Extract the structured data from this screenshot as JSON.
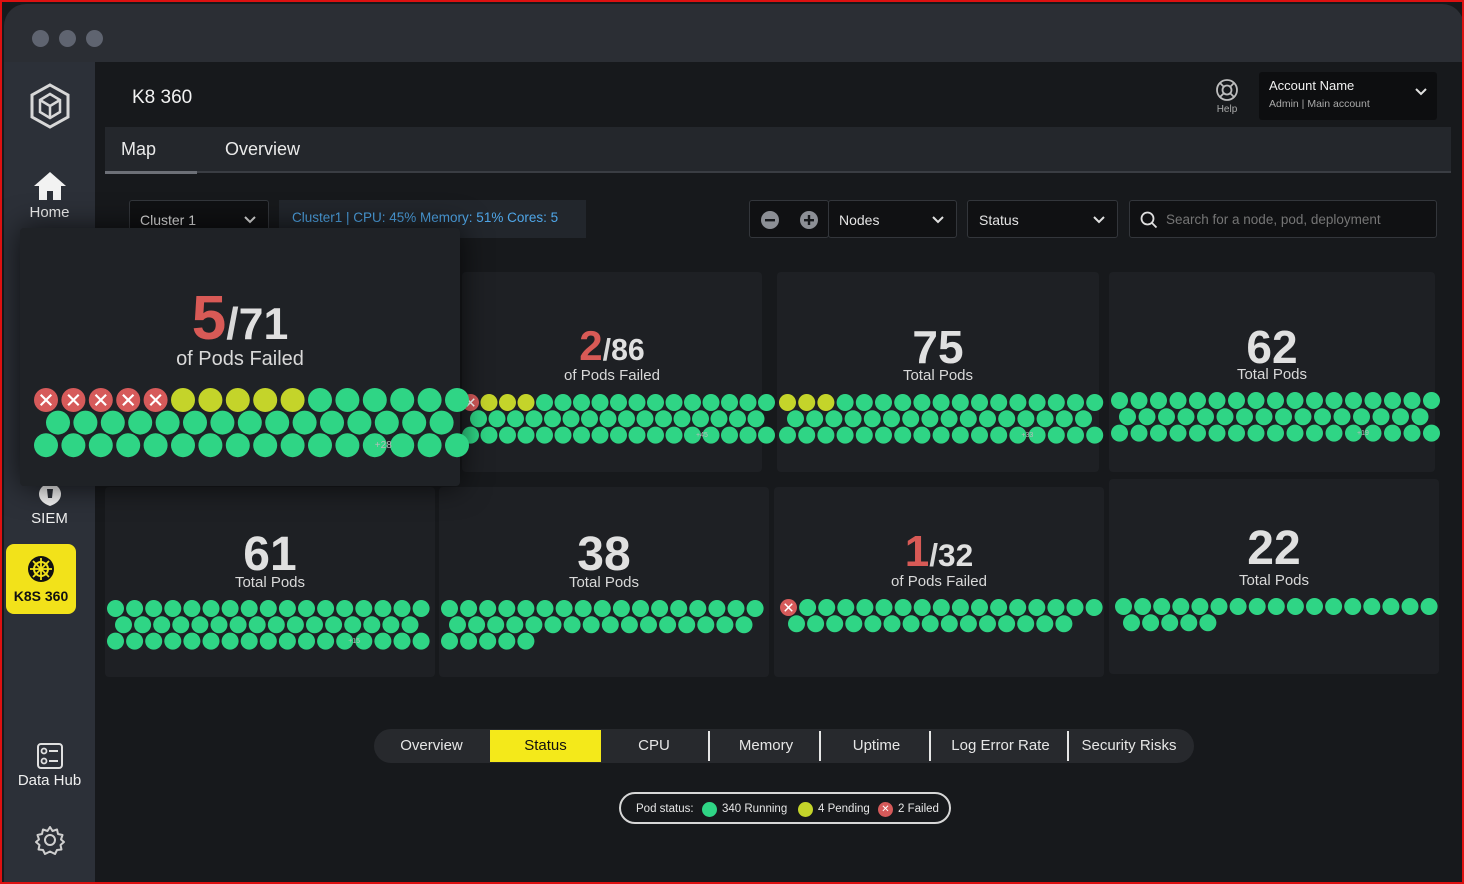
{
  "app": {
    "title": "K8 360"
  },
  "sidebar": {
    "items": [
      {
        "label": "Home"
      },
      {
        "label": "SIEM"
      },
      {
        "label": "K8S 360"
      },
      {
        "label": "Data Hub"
      }
    ]
  },
  "header": {
    "help_label": "Help",
    "account_name": "Account Name",
    "account_role": "Admin  |  Main account"
  },
  "tabs": [
    {
      "label": "Map"
    },
    {
      "label": "Overview"
    }
  ],
  "controls": {
    "cluster_select": "Cluster 1",
    "cluster_info": "Cluster1 | CPU: 45%  Memory: 51%  Cores: 5",
    "view_select": "Nodes",
    "filter_select": "Status",
    "search_placeholder": "Search for a node, pod, deployment"
  },
  "colors": {
    "running": "#2fd585",
    "pending": "#c4d42a",
    "failed": "#d65a5a",
    "active_tab": "#f4e91a"
  },
  "nodes": [
    {
      "failed": 5,
      "pending": 5,
      "running": 61,
      "big_failed": "5",
      "big_total": "71",
      "sub": "of Pods Failed",
      "more": "+28"
    },
    {
      "failed": 1,
      "pending": 3,
      "running": 82,
      "big_failed": "2",
      "big_total": "86",
      "sub": "of Pods Failed",
      "more": "+45"
    },
    {
      "failed": 0,
      "pending": 3,
      "running": 72,
      "big_total": "75",
      "sub": "Total Pods",
      "more": "+33"
    },
    {
      "failed": 0,
      "pending": 0,
      "running": 62,
      "big_total": "62",
      "sub": "Total Pods",
      "more": "+19"
    },
    {
      "failed": 0,
      "pending": 0,
      "running": 61,
      "big_total": "61",
      "sub": "Total Pods",
      "more": "+15"
    },
    {
      "failed": 0,
      "pending": 0,
      "running": 38,
      "big_total": "38",
      "sub": "Total Pods",
      "more": ""
    },
    {
      "failed": 1,
      "pending": 0,
      "running": 31,
      "big_failed": "1",
      "big_total": "32",
      "sub": "of Pods Failed",
      "more": ""
    },
    {
      "failed": 0,
      "pending": 0,
      "running": 22,
      "big_total": "22",
      "sub": "Total Pods",
      "more": ""
    }
  ],
  "metric_tabs": [
    {
      "label": "Overview"
    },
    {
      "label": "Status"
    },
    {
      "label": "CPU"
    },
    {
      "label": "Memory"
    },
    {
      "label": "Uptime"
    },
    {
      "label": "Log Error Rate"
    },
    {
      "label": "Security Risks"
    }
  ],
  "legend": {
    "title": "Pod status:",
    "running": "340 Running",
    "pending": "4 Pending",
    "failed": "2 Failed"
  }
}
